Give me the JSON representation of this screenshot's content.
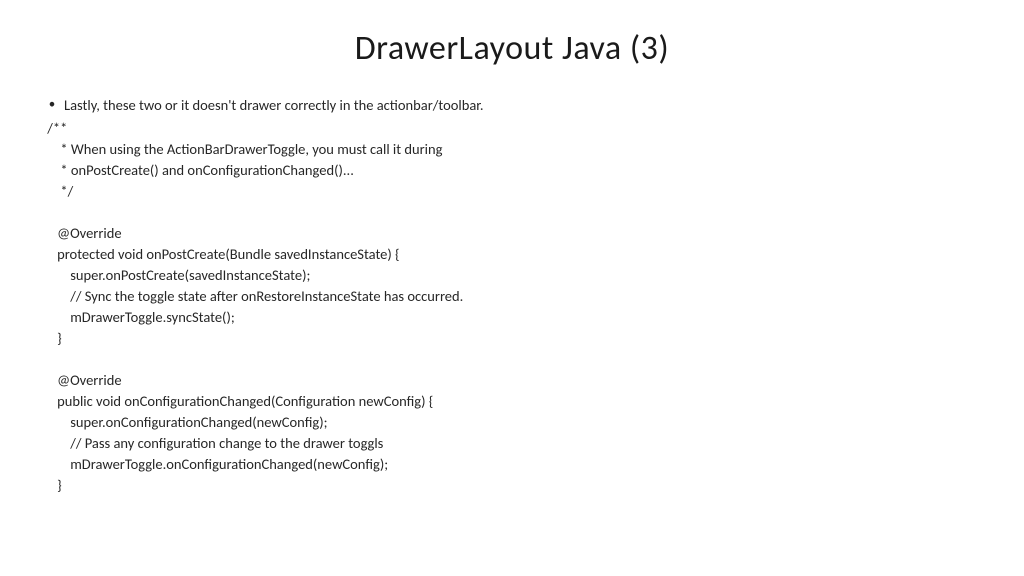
{
  "slide": {
    "title": "DrawerLayout Java (3)",
    "bullet_text": "Lastly, these two or it doesn't drawer correctly in the actionbar/toolbar.",
    "code_lines": {
      "l00": " /**",
      "l01": "     * When using the ActionBarDrawerToggle, you must call it during",
      "l02": "     * onPostCreate() and onConfigurationChanged()...",
      "l03": "     */",
      "l04": "",
      "l05": "    @Override",
      "l06": "    protected void onPostCreate(Bundle savedInstanceState) {",
      "l07": "        super.onPostCreate(savedInstanceState);",
      "l08": "        // Sync the toggle state after onRestoreInstanceState has occurred.",
      "l09": "        mDrawerToggle.syncState();",
      "l10": "    }",
      "l11": "",
      "l12": "    @Override",
      "l13": "    public void onConfigurationChanged(Configuration newConfig) {",
      "l14": "        super.onConfigurationChanged(newConfig);",
      "l15": "        // Pass any configuration change to the drawer toggls",
      "l16": "        mDrawerToggle.onConfigurationChanged(newConfig);",
      "l17": "    }"
    }
  }
}
